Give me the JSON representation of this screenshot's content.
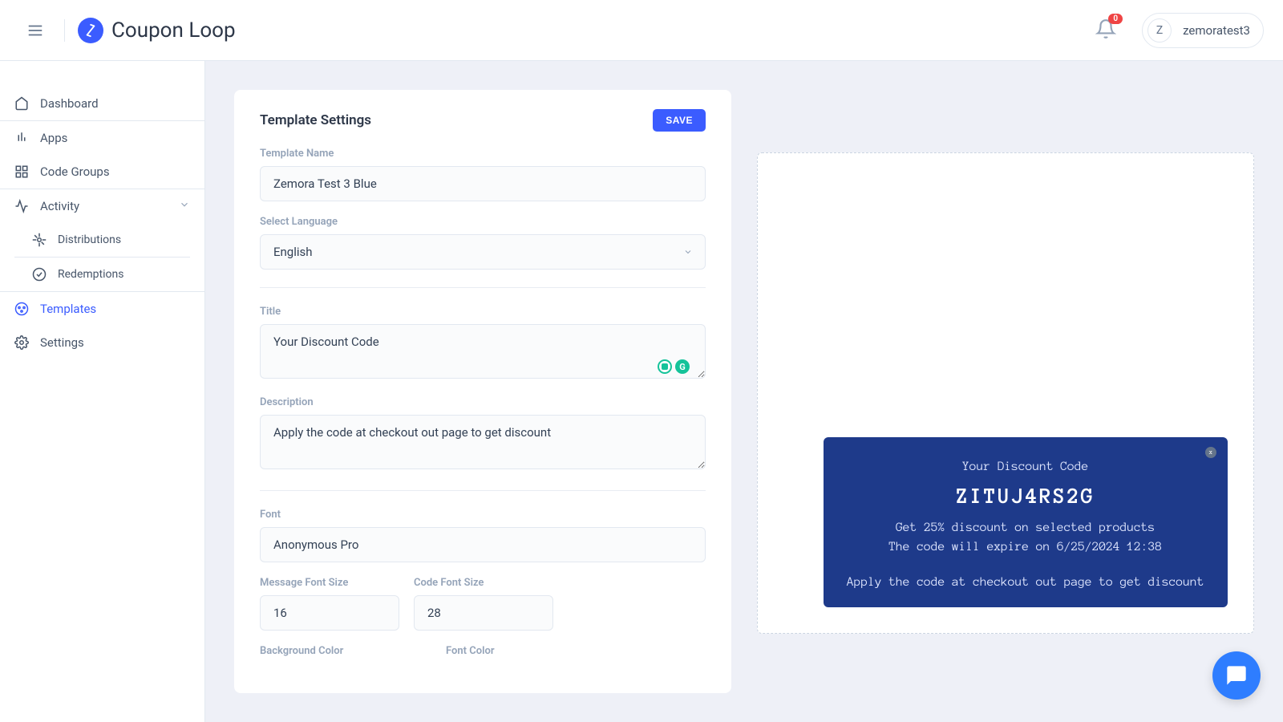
{
  "header": {
    "app_name": "Coupon Loop",
    "notif_count": "0",
    "avatar_letter": "Z",
    "username": "zemoratest3"
  },
  "sidebar": {
    "dashboard": "Dashboard",
    "apps": "Apps",
    "code_groups": "Code Groups",
    "activity": "Activity",
    "distributions": "Distributions",
    "redemptions": "Redemptions",
    "templates": "Templates",
    "settings": "Settings"
  },
  "panel": {
    "title": "Template Settings",
    "save_label": "SAVE",
    "labels": {
      "template_name": "Template Name",
      "select_language": "Select Language",
      "title": "Title",
      "description": "Description",
      "font": "Font",
      "message_font_size": "Message Font Size",
      "code_font_size": "Code Font Size",
      "background_color": "Background Color",
      "font_color": "Font Color"
    },
    "values": {
      "template_name": "Zemora Test 3 Blue",
      "language": "English",
      "title": "Your Discount Code",
      "description": "Apply the code at checkout out page to get discount",
      "font": "Anonymous Pro",
      "message_font_size": "16",
      "code_font_size": "28"
    },
    "grammarly_letter": "G"
  },
  "preview": {
    "close_glyph": "x",
    "title": "Your Discount Code",
    "code": "ZITUJ4RS2G",
    "discount_line": "Get 25% discount on selected products",
    "expire_line": "The code will expire on 6/25/2024 12:38",
    "description": "Apply the code at checkout out page to get discount"
  }
}
